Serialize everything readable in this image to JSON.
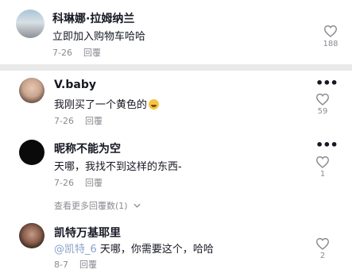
{
  "comments": [
    {
      "name": "科琳娜·拉姆纳兰",
      "text": "立即加入购物车哈哈",
      "date": "7-26",
      "reply": "回覆",
      "likes": "188"
    },
    {
      "name": "V.baby",
      "text": "我刚买了一个黄色的",
      "emoji": "grimacing-emoji",
      "date": "7-26",
      "reply": "回覆",
      "likes": "59"
    },
    {
      "name": "昵称不能为空",
      "text": "天哪，我找不到这样的东西-",
      "date": "7-26",
      "reply": "回覆",
      "likes": "1"
    },
    {
      "name": "凯特万基耶里",
      "mention": "@凯特_6",
      "text": " 天哪，你需要这个，哈哈",
      "date": "8-7",
      "reply": "回覆",
      "likes": "2"
    }
  ],
  "view_more_replies": "查看更多回覆数(1)",
  "icons": {
    "like": "heart-outline-icon",
    "options": "more-options-icon",
    "expand": "chevron-down-icon"
  },
  "colors": {
    "text": "#161823",
    "muted": "#8a8b91",
    "mention": "#8aa3c9",
    "separator": "#e9e9e9"
  }
}
